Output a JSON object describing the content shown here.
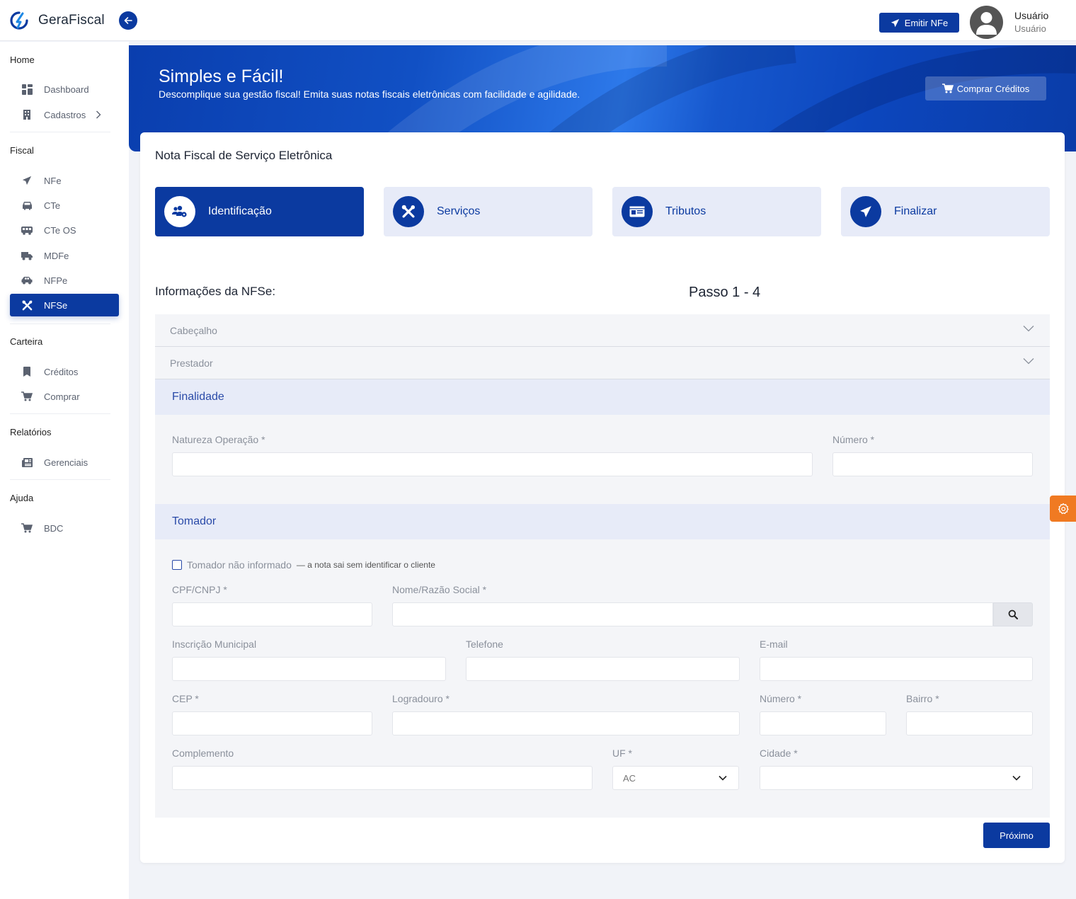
{
  "app": {
    "name": "GeraFiscal"
  },
  "header": {
    "emit_label": "Emitir NFe",
    "user_name": "Usuário",
    "user_role": "Usuário"
  },
  "sidebar": {
    "sections": [
      {
        "title": "Home",
        "items": [
          {
            "label": "Dashboard",
            "icon": "dashboard-icon"
          },
          {
            "label": "Cadastros",
            "icon": "building-icon"
          }
        ]
      },
      {
        "title": "Fiscal",
        "items": [
          {
            "label": "NFe",
            "icon": "send-icon"
          },
          {
            "label": "CTe",
            "icon": "car-icon"
          },
          {
            "label": "CTe OS",
            "icon": "bus-icon"
          },
          {
            "label": "MDFe",
            "icon": "truck-icon"
          },
          {
            "label": "NFPe",
            "icon": "car-side-icon"
          },
          {
            "label": "NFSe",
            "icon": "tools-icon",
            "active": true
          }
        ]
      },
      {
        "title": "Carteira",
        "items": [
          {
            "label": "Créditos",
            "icon": "bookmark-icon"
          },
          {
            "label": "Comprar",
            "icon": "cart-icon"
          }
        ]
      },
      {
        "title": "Relatórios",
        "items": [
          {
            "label": "Gerenciais",
            "icon": "newspaper-icon"
          }
        ]
      },
      {
        "title": "Ajuda",
        "items": [
          {
            "label": "BDC",
            "icon": "cart-icon"
          }
        ]
      }
    ]
  },
  "banner": {
    "title": "Simples e Fácil!",
    "subtitle": "Descomplique sua gestão fiscal! Emita suas notas fiscais eletrônicas com facilidade e agilidade.",
    "buy_label": "Comprar Créditos"
  },
  "card": {
    "title": "Nota Fiscal de Serviço Eletrônica",
    "steps": [
      {
        "label": "Identificação",
        "icon": "users-cog-icon",
        "active": true
      },
      {
        "label": "Serviços",
        "icon": "tools-icon"
      },
      {
        "label": "Tributos",
        "icon": "id-card-icon"
      },
      {
        "label": "Finalizar",
        "icon": "send-icon"
      }
    ],
    "info_title": "Informações da NFSe:",
    "step_counter": "Passo 1 - 4",
    "accordions": [
      "Cabeçalho",
      "Prestador"
    ]
  },
  "finalidade": {
    "title": "Finalidade",
    "natureza_label": "Natureza Operação *",
    "natureza_value": "",
    "numero_label": "Número *",
    "numero_value": ""
  },
  "tomador": {
    "title": "Tomador",
    "checkbox_label": "Tomador não informado",
    "checkbox_hint": " — a nota sai sem identificar o cliente",
    "checkbox_checked": false,
    "cpf_label": "CPF/CNPJ *",
    "nome_label": "Nome/Razão Social *",
    "im_label": "Inscrição Municipal",
    "telefone_label": "Telefone",
    "email_label": "E-mail",
    "cep_label": "CEP *",
    "logradouro_label": "Logradouro *",
    "numero_label": "Número *",
    "bairro_label": "Bairro *",
    "complemento_label": "Complemento",
    "uf_label": "UF *",
    "uf_value": "AC",
    "cidade_label": "Cidade *",
    "cidade_value": ""
  },
  "actions": {
    "next_label": "Próximo"
  },
  "colors": {
    "primary": "#0b3aa0",
    "accent": "#f07a22",
    "section_bg": "#e7ebf8"
  }
}
